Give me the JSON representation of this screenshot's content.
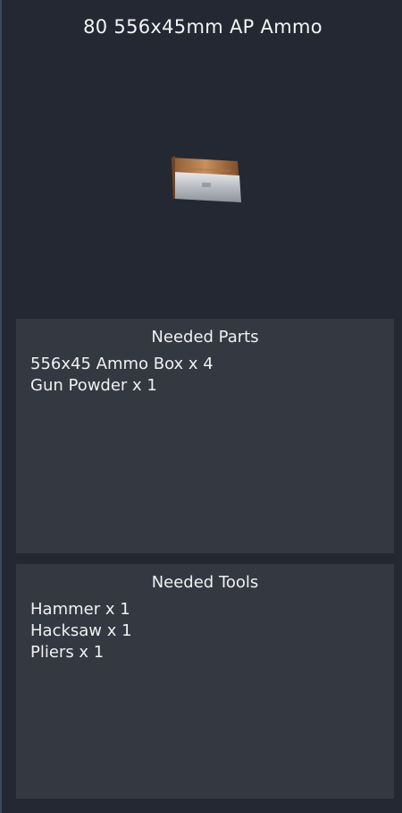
{
  "item": {
    "title": "80 556x45mm AP Ammo",
    "image_icon": "ammo-box-icon"
  },
  "needed_parts": {
    "header": "Needed Parts",
    "items": [
      "556x45 Ammo Box x 4",
      "Gun Powder x 1"
    ]
  },
  "needed_tools": {
    "header": "Needed Tools",
    "items": [
      "Hammer x 1",
      "Hacksaw x 1",
      "Pliers x 1"
    ]
  },
  "colors": {
    "background": "#242832",
    "section_background": "#343841",
    "text": "#f0f0f0"
  }
}
